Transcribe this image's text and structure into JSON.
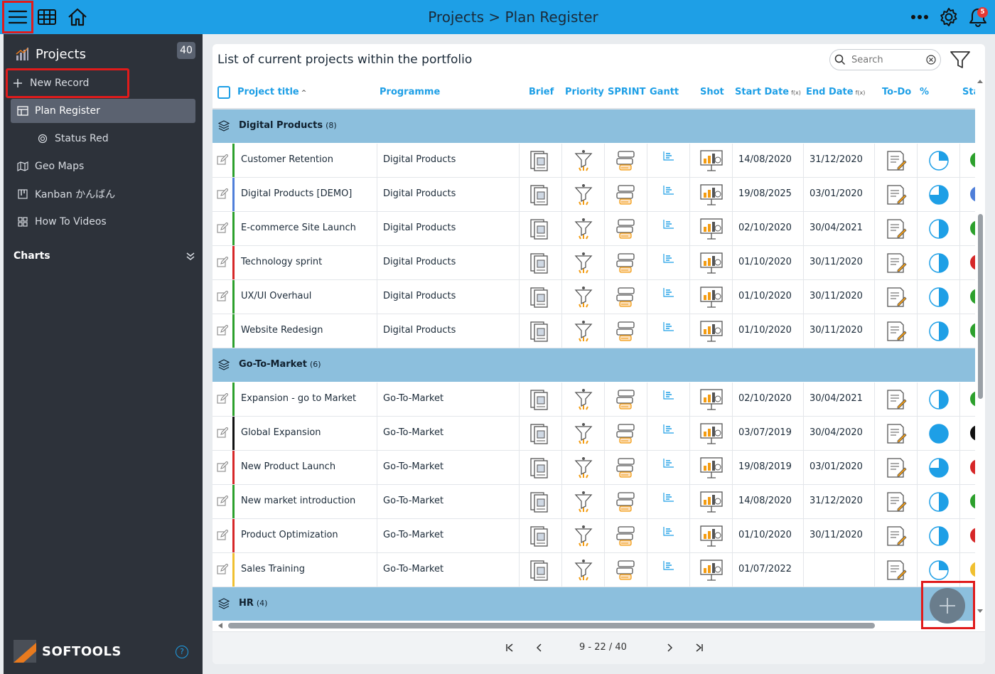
{
  "header": {
    "title": "Projects > Plan Register",
    "notifications": "5",
    "icons": [
      "menu-icon",
      "grid-icon",
      "home-icon",
      "more-icon",
      "settings-icon",
      "bell-icon"
    ]
  },
  "sidebar": {
    "title": "Projects",
    "count": "40",
    "items": [
      {
        "label": "New Record",
        "icon": "plus-icon"
      },
      {
        "label": "Plan Register",
        "icon": "table-icon"
      },
      {
        "label": "Status Red",
        "icon": "circle-icon"
      },
      {
        "label": "Geo Maps",
        "icon": "map-icon"
      },
      {
        "label": "Kanban かんばん",
        "icon": "kanban-icon"
      },
      {
        "label": "How To Videos",
        "icon": "video-icon"
      }
    ],
    "charts_label": "Charts",
    "logo_text": "SOFTOOLS",
    "help": "?"
  },
  "main": {
    "title": "List of current projects within the portfolio",
    "search_placeholder": "Search",
    "columns": {
      "title": "Project title",
      "sort": "^",
      "programme": "Programme",
      "brief": "Brief",
      "priority": "Priority",
      "sprint": "SPRINT",
      "gantt": "Gantt",
      "shot": "Shot",
      "start": "Start Date",
      "end": "End Date",
      "fx": "f(x)",
      "todo": "To-Do",
      "pct": "%",
      "status": "Sta"
    },
    "groups": [
      {
        "name": "Digital Products",
        "count": "(8)"
      },
      {
        "name": "Go-To-Market",
        "count": "(6)"
      },
      {
        "name": "HR",
        "count": "(4)"
      }
    ],
    "rows": [
      {
        "title": "Customer Retention",
        "programme": "Digital Products",
        "start": "14/08/2020",
        "end": "31/12/2020",
        "bar": "#2ca02c",
        "progress": 0.25,
        "status": "#2ca02c"
      },
      {
        "title": "Digital Products [DEMO]",
        "programme": "Digital Products",
        "start": "19/08/2025",
        "end": "03/01/2020",
        "bar": "#4f7fd9",
        "progress": 0.75,
        "status": "#4f7fd9"
      },
      {
        "title": "E-commerce Site Launch",
        "programme": "Digital Products",
        "start": "02/10/2020",
        "end": "30/04/2021",
        "bar": "#2ca02c",
        "progress": 0.5,
        "status": "#2ca02c"
      },
      {
        "title": "Technology sprint",
        "programme": "Digital Products",
        "start": "01/10/2020",
        "end": "30/11/2020",
        "bar": "#d62728",
        "progress": 0.5,
        "status": "#d62728"
      },
      {
        "title": "UX/UI Overhaul",
        "programme": "Digital Products",
        "start": "01/10/2020",
        "end": "30/11/2020",
        "bar": "#2ca02c",
        "progress": 0.5,
        "status": "#2ca02c"
      },
      {
        "title": "Website Redesign",
        "programme": "Digital Products",
        "start": "01/10/2020",
        "end": "30/11/2020",
        "bar": "#2ca02c",
        "progress": 0.5,
        "status": "#2ca02c"
      },
      {
        "title": "Expansion - go to Market",
        "programme": "Go-To-Market",
        "start": "02/10/2020",
        "end": "30/04/2021",
        "bar": "#2ca02c",
        "progress": 0.5,
        "status": "#2ca02c"
      },
      {
        "title": "Global Expansion",
        "programme": "Go-To-Market",
        "start": "03/07/2019",
        "end": "30/04/2020",
        "bar": "#111111",
        "progress": 1.0,
        "status": "#111111"
      },
      {
        "title": "New Product Launch",
        "programme": "Go-To-Market",
        "start": "19/08/2019",
        "end": "03/01/2020",
        "bar": "#d62728",
        "progress": 0.75,
        "status": "#d62728"
      },
      {
        "title": "New market introduction",
        "programme": "Go-To-Market",
        "start": "14/08/2020",
        "end": "31/12/2020",
        "bar": "#2ca02c",
        "progress": 0.5,
        "status": "#2ca02c"
      },
      {
        "title": "Product Optimization",
        "programme": "Go-To-Market",
        "start": "01/10/2020",
        "end": "30/11/2020",
        "bar": "#d62728",
        "progress": 0.5,
        "status": "#d62728"
      },
      {
        "title": "Sales Training",
        "programme": "Go-To-Market",
        "start": "01/07/2022",
        "end": "",
        "bar": "#f0c030",
        "progress": 0.25,
        "status": "#f0c030"
      }
    ]
  },
  "pager": {
    "info": "9 - 22 / 40"
  },
  "colors": {
    "accent": "#1e9fe6",
    "group_bg": "#8cbfdd",
    "sidebar_bg": "#2d323a",
    "highlight": "#e01b1b"
  }
}
